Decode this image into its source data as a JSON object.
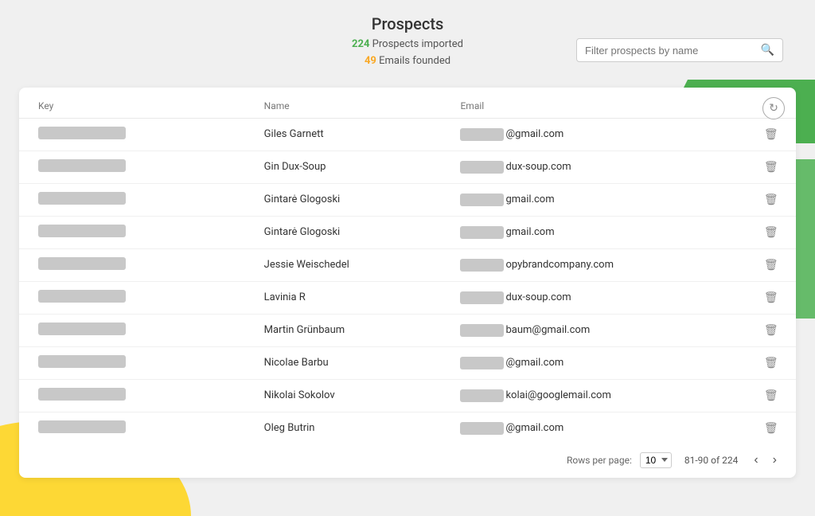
{
  "header": {
    "title": "Prospects",
    "stats": {
      "prospects_count": "224",
      "prospects_label": "Prospects imported",
      "emails_count": "49",
      "emails_label": "Emails founded"
    }
  },
  "search": {
    "placeholder": "Filter prospects by name"
  },
  "table": {
    "columns": [
      "Key",
      "Name",
      "Email"
    ],
    "rows": [
      {
        "key": "",
        "name": "Giles Garnett",
        "email_prefix": "",
        "email_suffix": "@gmail.com"
      },
      {
        "key": "",
        "name": "Gin Dux-Soup",
        "email_prefix": "",
        "email_suffix": "dux-soup.com"
      },
      {
        "key": "",
        "name": "Gintarė Glogoski",
        "email_prefix": "",
        "email_suffix": "gmail.com"
      },
      {
        "key": "",
        "name": "Gintarė Glogoski",
        "email_prefix": "",
        "email_suffix": "gmail.com"
      },
      {
        "key": "",
        "name": "Jessie Weischedel",
        "email_prefix": "",
        "email_suffix": "opybrandcompany.com"
      },
      {
        "key": "",
        "name": "Lavinia R",
        "email_prefix": "",
        "email_suffix": "dux-soup.com"
      },
      {
        "key": "",
        "name": "Martin Grünbaum",
        "email_prefix": "",
        "email_suffix": "baum@gmail.com"
      },
      {
        "key": "",
        "name": "Nicolae Barbu",
        "email_prefix": "",
        "email_suffix": "@gmail.com"
      },
      {
        "key": "",
        "name": "Nikolai Sokolov",
        "email_prefix": "",
        "email_suffix": "kolai@googlemail.com"
      },
      {
        "key": "",
        "name": "Oleg Butrin",
        "email_prefix": "",
        "email_suffix": "@gmail.com"
      }
    ],
    "col_key": "Key",
    "col_name": "Name",
    "col_email": "Email"
  },
  "pagination": {
    "rows_per_page_label": "Rows per page:",
    "rows_per_page_value": "10",
    "range": "81-90 of 224",
    "prev_label": "‹",
    "next_label": "›"
  },
  "refresh_icon": "↻"
}
